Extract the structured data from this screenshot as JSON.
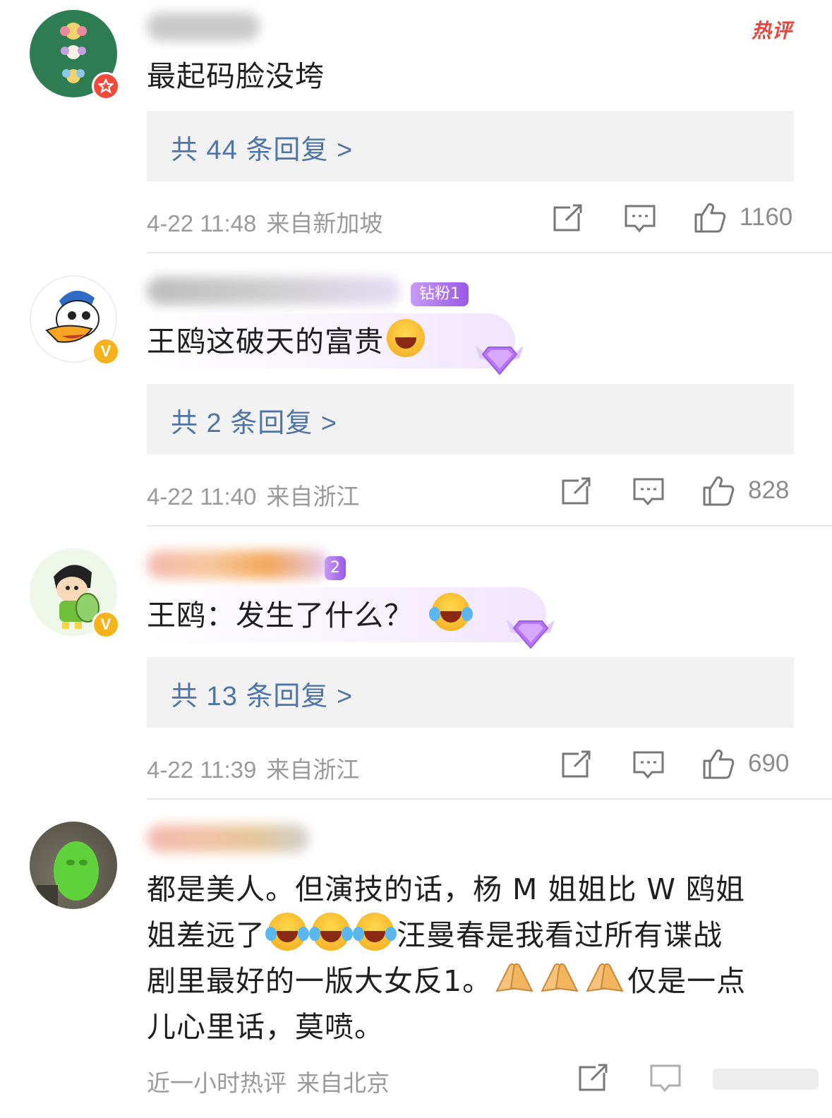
{
  "hot_tag": "热评",
  "comments": [
    {
      "text": "最起码脸没垮",
      "replies_label": "共 44 条回复 >",
      "date": "4-22 11:48",
      "location": "来自新加坡",
      "likes": "1160",
      "avatar_badge": "star"
    },
    {
      "fan_badge": "钻粉1",
      "text": "王鸥这破天的富贵",
      "replies_label": "共 2 条回复 >",
      "date": "4-22 11:40",
      "location": "来自浙江",
      "likes": "828",
      "avatar_badge": "V"
    },
    {
      "fan_badge": "2",
      "text": "王鸥：发生了什么？",
      "replies_label": "共 13 条回复 >",
      "date": "4-22 11:39",
      "location": "来自浙江",
      "likes": "690",
      "avatar_badge": "V"
    },
    {
      "text_line1": "都是美人。但演技的话，杨 M 姐姐比 W 鸥姐",
      "text_line2a": "姐差远了",
      "text_line2b": "汪曼春是我看过所有谍战",
      "text_line3a": "剧里最好的一版大女反1。",
      "text_line3b": "仅是一点",
      "text_line4": "儿心里话，莫喷。",
      "date": "近一小时热评",
      "location": "来自北京"
    }
  ],
  "icons": {
    "share": "share-icon",
    "comment": "comment-icon",
    "like": "thumbs-up-icon"
  },
  "colors": {
    "reply_link": "#4f74a8",
    "hot_tag": "#e8453c",
    "verified_gold": "#f6b21a",
    "fan_badge": "#9a57e8"
  }
}
